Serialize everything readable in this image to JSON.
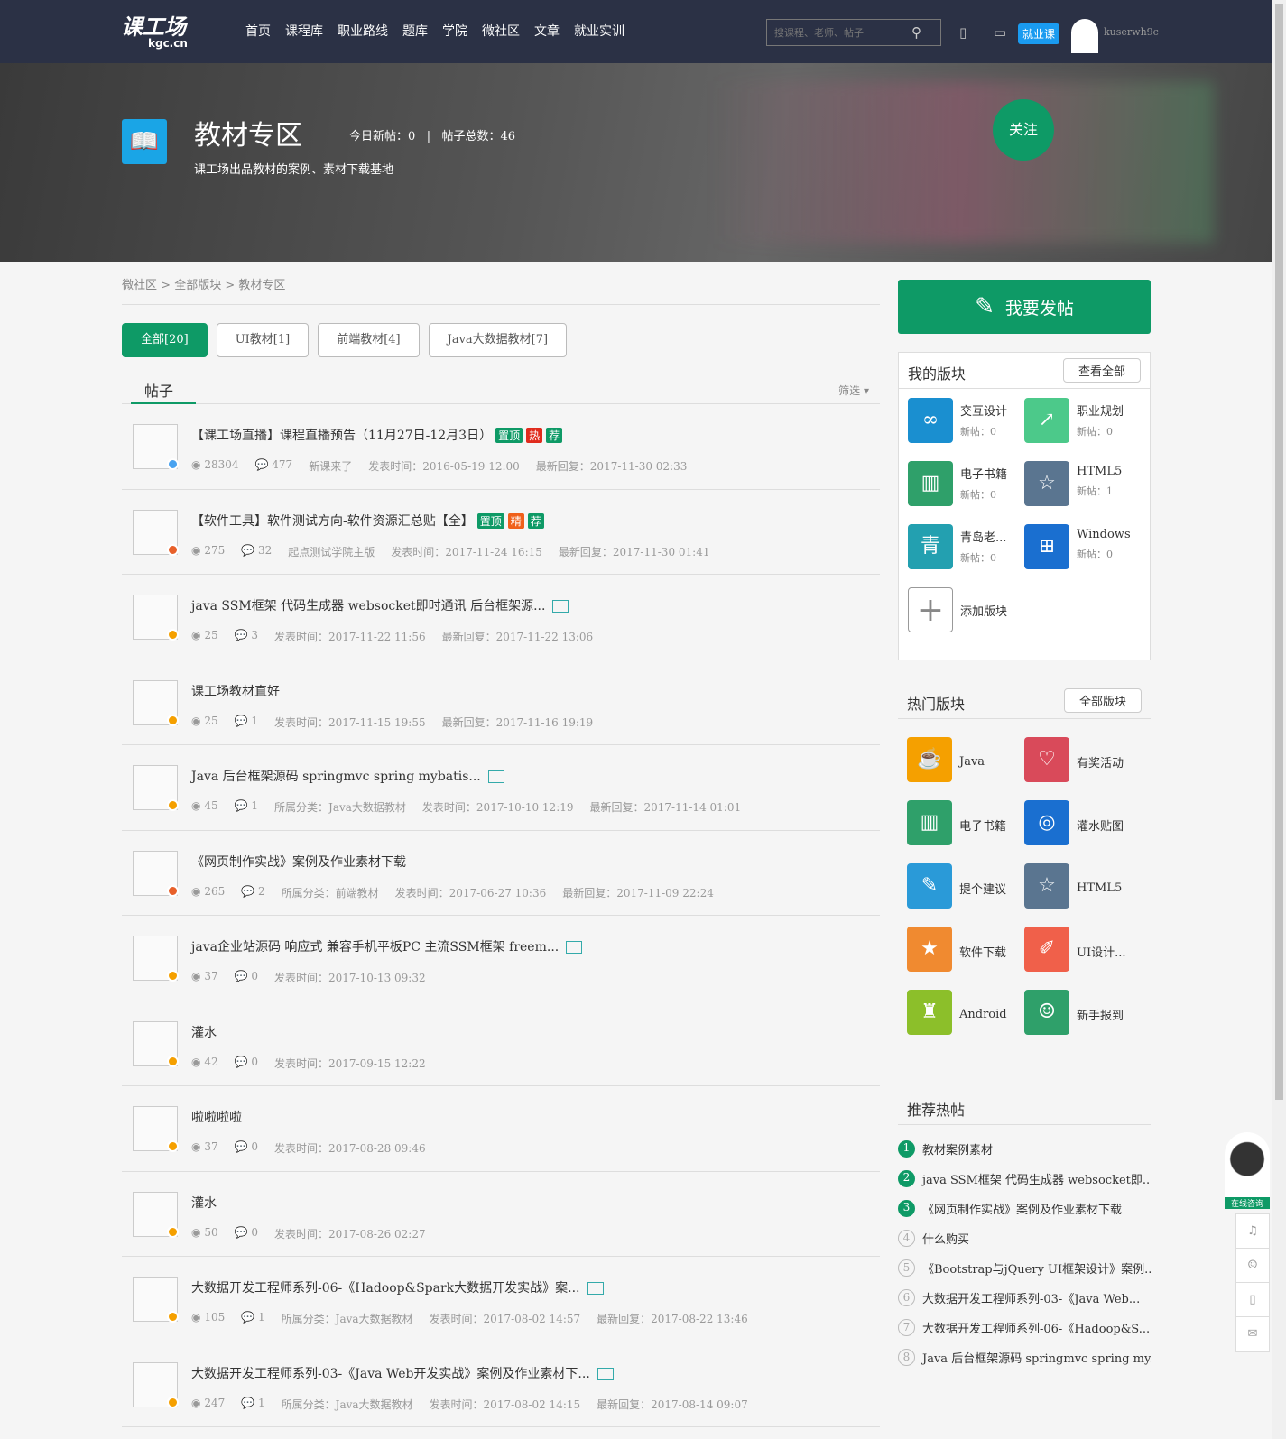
{
  "header": {
    "logo": "课工场",
    "logo_sub": "kgc.cn",
    "nav": [
      "首页",
      "课程库",
      "职业路线",
      "题库",
      "学院",
      "微社区",
      "文章",
      "就业实训"
    ],
    "search_placeholder": "搜课程、老师、帖子",
    "job_badge": "就业课",
    "username": "kuserwh9c"
  },
  "banner": {
    "title": "教材专区",
    "today": "今日新帖：0",
    "sep": "|",
    "total": "帖子总数：46",
    "desc": "课工场出品教材的案例、素材下载基地",
    "follow": "关注"
  },
  "breadcrumb": [
    "微社区",
    " > ",
    "全部版块",
    " > ",
    "教材专区"
  ],
  "tabs": [
    "全部[20]",
    "UI教材[1]",
    "前端教材[4]",
    "Java大数据教材[7]"
  ],
  "section": {
    "title": "帖子",
    "filter": "筛选 ▾"
  },
  "posts": [
    {
      "title": "【课工场直播】课程直播预告（11月27日-12月3日）",
      "tags": [
        [
          "置顶",
          "#0e9a66"
        ],
        [
          "热",
          "#e02b1d"
        ],
        [
          "荐",
          "#0e9a66"
        ]
      ],
      "img": false,
      "badge": "#4aa3f0",
      "views": "28304",
      "comments": "477",
      "meta": [
        "新课来了",
        "发表时间：2016-05-19 12:00",
        "最新回复：2017-11-30 02:33"
      ]
    },
    {
      "title": "【软件工具】软件测试方向-软件资源汇总贴【全】",
      "tags": [
        [
          "置顶",
          "#0e9a66"
        ],
        [
          "精",
          "#f0601a"
        ],
        [
          "荐",
          "#0e9a66"
        ]
      ],
      "img": false,
      "badge": "#e8602a",
      "views": "275",
      "comments": "32",
      "meta": [
        "起点测试学院主版",
        "发表时间：2017-11-24 16:15",
        "最新回复：2017-11-30 01:41"
      ]
    },
    {
      "title": "java SSM框架 代码生成器 websocket即时通讯 后台框架源...",
      "tags": [],
      "img": true,
      "badge": "#f5a000",
      "views": "25",
      "comments": "3",
      "meta": [
        "发表时间：2017-11-22 11:56",
        "最新回复：2017-11-22 13:06"
      ]
    },
    {
      "title": "课工场教材直好",
      "tags": [],
      "img": false,
      "badge": "#f5a000",
      "views": "25",
      "comments": "1",
      "meta": [
        "发表时间：2017-11-15 19:55",
        "最新回复：2017-11-16 19:19"
      ]
    },
    {
      "title": "Java 后台框架源码 springmvc spring mybatis...",
      "tags": [],
      "img": true,
      "badge": "#f5a000",
      "views": "45",
      "comments": "1",
      "meta": [
        "所属分类：Java大数据教材",
        "发表时间：2017-10-10 12:19",
        "最新回复：2017-11-14 01:01"
      ]
    },
    {
      "title": "《网页制作实战》案例及作业素材下载",
      "tags": [],
      "img": false,
      "badge": "#e8602a",
      "views": "265",
      "comments": "2",
      "meta": [
        "所属分类：前端教材",
        "发表时间：2017-06-27 10:36",
        "最新回复：2017-11-09 22:24"
      ]
    },
    {
      "title": "java企业站源码 响应式 兼容手机平板PC 主流SSM框架 freem...",
      "tags": [],
      "img": true,
      "badge": "#f5a000",
      "views": "37",
      "comments": "0",
      "meta": [
        "发表时间：2017-10-13 09:32"
      ]
    },
    {
      "title": "灌水",
      "tags": [],
      "img": false,
      "badge": "#f5a000",
      "views": "42",
      "comments": "0",
      "meta": [
        "发表时间：2017-09-15 12:22"
      ]
    },
    {
      "title": "啦啦啦啦",
      "tags": [],
      "img": false,
      "badge": "#f5a000",
      "views": "37",
      "comments": "0",
      "meta": [
        "发表时间：2017-08-28 09:46"
      ]
    },
    {
      "title": "灌水",
      "tags": [],
      "img": false,
      "badge": "#f5a000",
      "views": "50",
      "comments": "0",
      "meta": [
        "发表时间：2017-08-26 02:27"
      ]
    },
    {
      "title": "大数据开发工程师系列-06-《Hadoop&Spark大数据开发实战》案...",
      "tags": [],
      "img": true,
      "badge": "#f5a000",
      "views": "105",
      "comments": "1",
      "meta": [
        "所属分类：Java大数据教材",
        "发表时间：2017-08-02 14:57",
        "最新回复：2017-08-22 13:46"
      ]
    },
    {
      "title": "大数据开发工程师系列-03-《Java Web开发实战》案例及作业素材下...",
      "tags": [],
      "img": true,
      "badge": "#f5a000",
      "views": "247",
      "comments": "1",
      "meta": [
        "所属分类：Java大数据教材",
        "发表时间：2017-08-02 14:15",
        "最新回复：2017-08-14 09:07"
      ]
    }
  ],
  "sidebar": {
    "post_button": "我要发帖",
    "my": {
      "title": "我的版块",
      "more": "查看全部",
      "items": [
        {
          "name": "交互设计",
          "sub": "新帖：0",
          "color": "#1a8fd0",
          "icon": "∞"
        },
        {
          "name": "职业规划",
          "sub": "新帖：0",
          "color": "#4cc98a",
          "icon": "↗"
        },
        {
          "name": "电子书籍",
          "sub": "新帖：0",
          "color": "#2fa06a",
          "icon": "▥"
        },
        {
          "name": "HTML5",
          "sub": "新帖：1",
          "color": "#5a7590",
          "icon": "☆"
        },
        {
          "name": "青岛老...",
          "sub": "新帖：0",
          "color": "#23a0b0",
          "icon": "青"
        },
        {
          "name": "Windows",
          "sub": "新帖：0",
          "color": "#1a6fd0",
          "icon": "⊞"
        }
      ],
      "add": "添加版块"
    },
    "hot": {
      "title": "热门版块",
      "more": "全部版块",
      "items": [
        {
          "name": "Java",
          "color": "#f5a000",
          "icon": "☕"
        },
        {
          "name": "有奖活动",
          "color": "#d94a5a",
          "icon": "♡"
        },
        {
          "name": "电子书籍",
          "color": "#2fa06a",
          "icon": "▥"
        },
        {
          "name": "灌水贴图",
          "color": "#1a6fd0",
          "icon": "◎"
        },
        {
          "name": "提个建议",
          "color": "#2a9ad8",
          "icon": "✎"
        },
        {
          "name": "HTML5",
          "color": "#5a7590",
          "icon": "☆"
        },
        {
          "name": "软件下载",
          "color": "#f08a30",
          "icon": "★"
        },
        {
          "name": "UI设计...",
          "color": "#f0604a",
          "icon": "✐"
        },
        {
          "name": "Android",
          "color": "#8cbf2a",
          "icon": "♜"
        },
        {
          "name": "新手报到",
          "color": "#2fa06a",
          "icon": "☺"
        }
      ]
    },
    "rec": {
      "title": "推荐热帖",
      "items": [
        "教材案例素材",
        "java SSM框架 代码生成器 websocket即...",
        "《网页制作实战》案例及作业素材下载",
        "什么购买",
        "《Bootstrap与jQuery UI框架设计》案例...",
        "大数据开发工程师系列-03-《Java Web...",
        "大数据开发工程师系列-06-《Hadoop&S...",
        "Java 后台框架源码 springmvc spring my..."
      ]
    }
  },
  "float": {
    "consult": "在线咨询"
  }
}
